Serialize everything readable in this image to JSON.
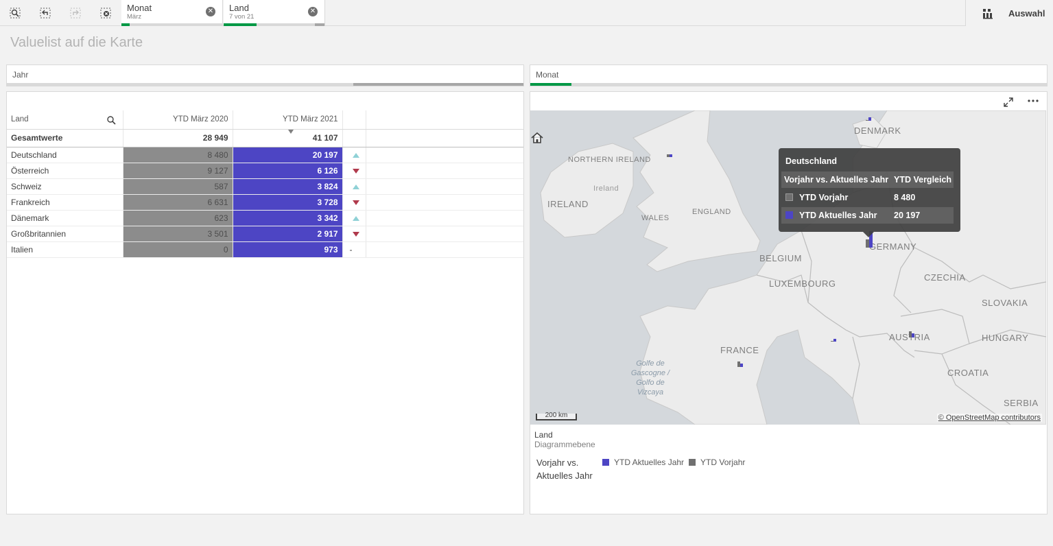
{
  "toolbar": {
    "selections": [
      {
        "title": "Monat",
        "subtitle": "März"
      },
      {
        "title": "Land",
        "subtitle": "7 von 21"
      }
    ],
    "right_label": "Auswahl"
  },
  "page_title": "Valuelist auf die Karte",
  "filters": {
    "jahr": "Jahr",
    "monat": "Monat"
  },
  "table": {
    "headers": {
      "land": "Land",
      "v1": "YTD März 2020",
      "v2": "YTD März 2021"
    },
    "total": {
      "label": "Gesamtwerte",
      "v1": "28 949",
      "v2": "41 107"
    },
    "rows": [
      {
        "land": "Deutschland",
        "v1": "8 480",
        "v2": "20 197",
        "trend": "up"
      },
      {
        "land": "Österreich",
        "v1": "9 127",
        "v2": "6 126",
        "trend": "down"
      },
      {
        "land": "Schweiz",
        "v1": "587",
        "v2": "3 824",
        "trend": "up"
      },
      {
        "land": "Frankreich",
        "v1": "6 631",
        "v2": "3 728",
        "trend": "down"
      },
      {
        "land": "Dänemark",
        "v1": "623",
        "v2": "3 342",
        "trend": "up"
      },
      {
        "land": "Großbritannien",
        "v1": "3 501",
        "v2": "2 917",
        "trend": "down"
      },
      {
        "land": "Italien",
        "v1": "0",
        "v2": "973",
        "trend": "none",
        "trend_text": "-"
      }
    ],
    "colors": {
      "prev": "#8c8c8c",
      "curr": "#4d45c4",
      "up": "#8fd1d6",
      "down": "#b03a4c"
    }
  },
  "map": {
    "labels": {
      "denmark": "DENMARK",
      "northern_ireland": "NORTHERN IRELAND",
      "ireland_local": "Ireland",
      "ireland": "IRELAND",
      "wales": "WALES",
      "england": "ENGLAND",
      "belgium": "BELGIUM",
      "germany": "GERMANY",
      "luxembourg": "LUXEMBOURG",
      "czechia": "CZECHIA",
      "slovakia": "SLOVAKIA",
      "austria": "AUSTRIA",
      "hungary": "HUNGARY",
      "france": "FRANCE",
      "croatia": "CROATIA",
      "serbia": "SERBIA",
      "sea_1": "Golfe de",
      "sea_2": "Gascogne /",
      "sea_3": "Golfo de",
      "sea_4": "Vizcaya"
    },
    "scale": "200 km",
    "attribution": "© OpenStreetMap contributors",
    "tooltip": {
      "title": "Deutschland",
      "col1": "Vorjahr vs. Aktuelles Jahr",
      "col2": "YTD Vergleich",
      "rows": [
        {
          "label": "YTD Vorjahr",
          "value": "8 480",
          "color": "#707070"
        },
        {
          "label": "YTD Aktuelles Jahr",
          "value": "20 197",
          "color": "#4d45c4"
        }
      ]
    },
    "layer_title": "Land",
    "layer_sub": "Diagrammebene",
    "legend_title_1": "Vorjahr vs.",
    "legend_title_2": "Aktuelles Jahr",
    "legend_items": [
      {
        "label": "YTD Aktuelles Jahr",
        "color": "#4d45c4"
      },
      {
        "label": "YTD Vorjahr",
        "color": "#707070"
      }
    ]
  }
}
